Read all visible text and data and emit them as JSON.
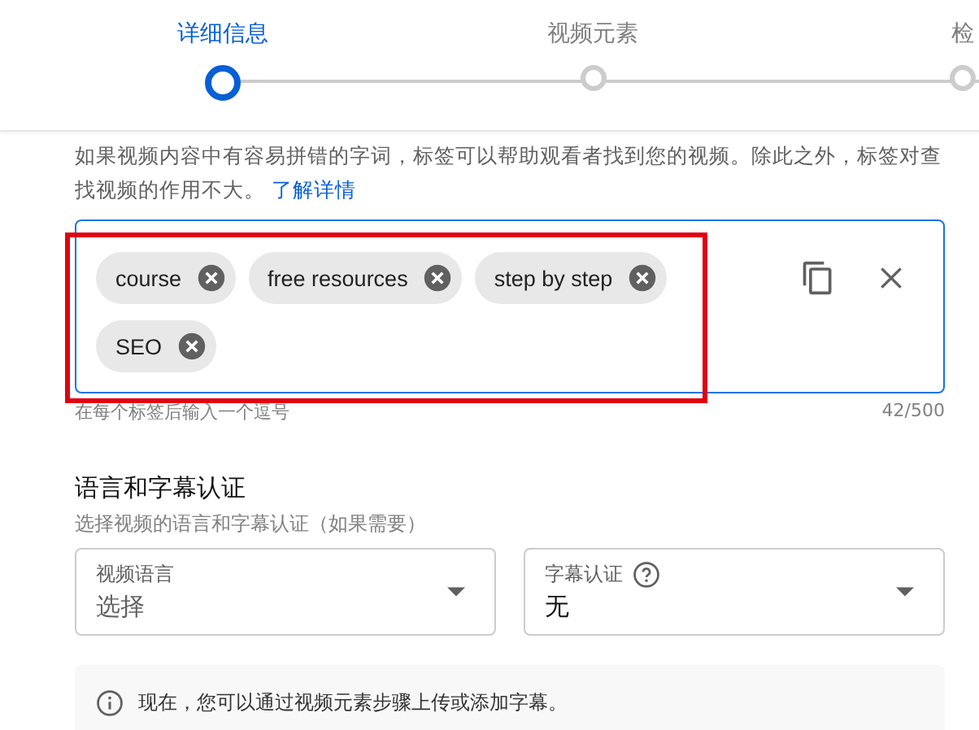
{
  "stepper": [
    {
      "label": "详细信息",
      "selected": true
    },
    {
      "label": "视频元素",
      "selected": false
    },
    {
      "label": "检",
      "selected": false
    }
  ],
  "tags_section": {
    "description": "如果视频内容中有容易拼错的字词，标签可以帮助观看者找到您的视频。除此之外，标签对查找视频的作用不大。",
    "learn_more": "了解详情",
    "tags": [
      "course",
      "free resources",
      "step by step",
      "SEO"
    ],
    "helper": "在每个标签后输入一个逗号",
    "counter": "42/500"
  },
  "language_section": {
    "title": "语言和字幕认证",
    "subtitle": "选择视频的语言和字幕认证（如果需要）",
    "selects": [
      {
        "label": "视频语言",
        "value": "选择",
        "help": false,
        "placeholder": true
      },
      {
        "label": "字幕认证",
        "value": "无",
        "help": true,
        "placeholder": false
      }
    ],
    "notice": "现在，您可以通过视频元素步骤上传或添加字幕。"
  }
}
